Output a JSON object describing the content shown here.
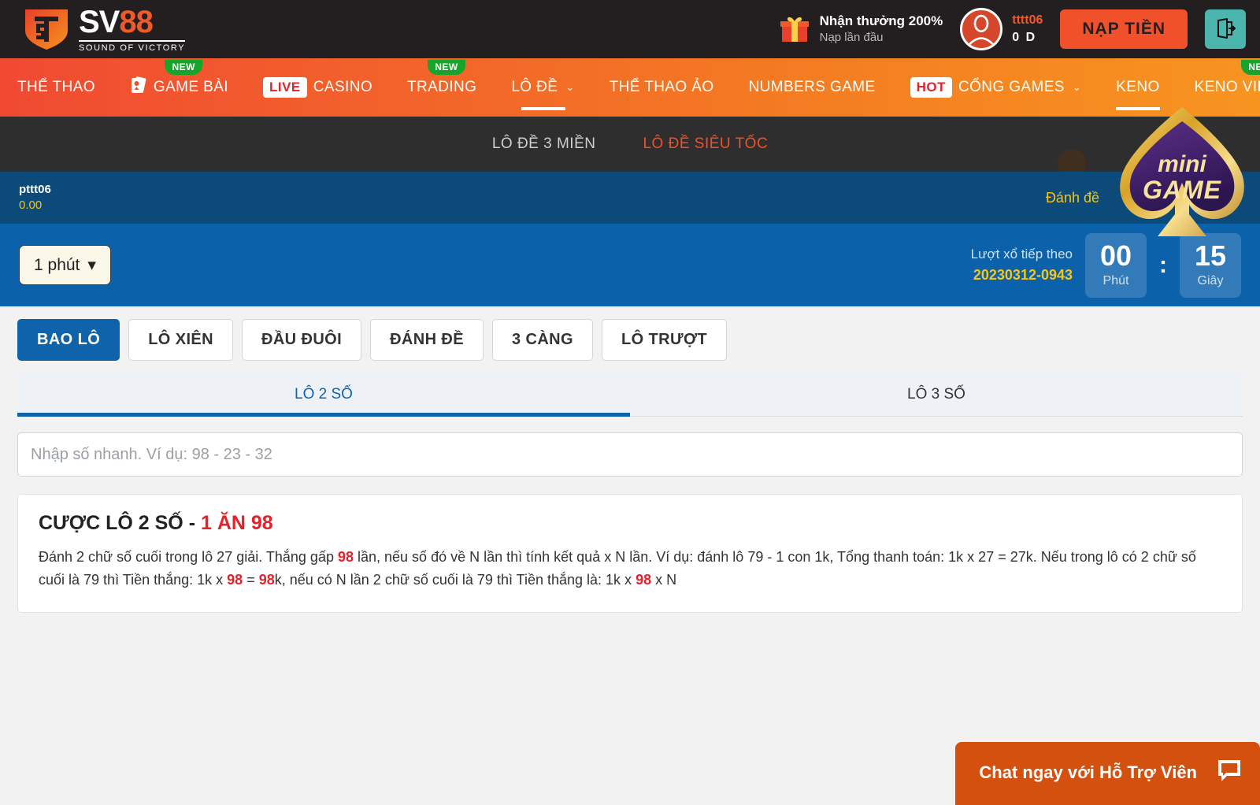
{
  "brand": {
    "name_main": "SV",
    "name_accent": "88",
    "tagline": "SOUND OF VICTORY",
    "logo_icon": "sv88-shield-logo",
    "accent_orange": "#f05a28",
    "dark": "#231f20"
  },
  "header": {
    "promo": {
      "icon": "gift-icon",
      "title": "Nhận thưởng 200%",
      "subtitle": "Nạp lần đầu"
    },
    "account": {
      "avatar_icon": "user-avatar-icon",
      "username": "tttt06",
      "balance": "0 D"
    },
    "deposit_label": "NẠP TIỀN",
    "logout_icon": "logout-icon"
  },
  "mainnav": {
    "items": [
      {
        "label": "THỂ THAO",
        "badge": "",
        "chip": "",
        "icon": "",
        "active": false,
        "caret": false
      },
      {
        "label": "GAME BÀI",
        "badge": "NEW",
        "chip": "",
        "icon": "cards-icon",
        "active": false,
        "caret": false
      },
      {
        "label": "CASINO",
        "badge": "",
        "chip": "LIVE",
        "icon": "",
        "active": false,
        "caret": false
      },
      {
        "label": "TRADING",
        "badge": "NEW",
        "chip": "",
        "icon": "",
        "active": false,
        "caret": false
      },
      {
        "label": "LÔ ĐỀ",
        "badge": "",
        "chip": "",
        "icon": "",
        "active": true,
        "caret": true
      },
      {
        "label": "THỂ THAO ẢO",
        "badge": "",
        "chip": "",
        "icon": "",
        "active": false,
        "caret": false
      },
      {
        "label": "NUMBERS GAME",
        "badge": "",
        "chip": "",
        "icon": "",
        "active": false,
        "caret": false
      },
      {
        "label": "CỔNG GAMES",
        "badge": "",
        "chip": "HOT",
        "icon": "",
        "active": false,
        "caret": true
      },
      {
        "label": "KENO",
        "badge": "",
        "chip": "",
        "icon": "",
        "active": true,
        "caret": false
      },
      {
        "label": "KENO VIETLOTT",
        "badge": "NEW",
        "chip": "",
        "icon": "",
        "active": false,
        "caret": false
      }
    ]
  },
  "subnav": {
    "items": [
      {
        "label": "LÔ ĐỀ 3 MIỀN",
        "active": false
      },
      {
        "label": "LÔ ĐỀ SIÊU TỐC",
        "active": true
      }
    ]
  },
  "userbar": {
    "username": "pttt06",
    "balance": "0.00",
    "right_label": "Đánh đề"
  },
  "timer": {
    "minute_select": "1 phút",
    "caret_icon": "caret-down-icon",
    "next_draw_label": "Lượt xổ tiếp theo",
    "draw_id": "20230312-0943",
    "minutes_value": "00",
    "minutes_label": "Phút",
    "separator": ":",
    "seconds_value": "15",
    "seconds_label": "Giây"
  },
  "bet_types": [
    {
      "label": "BAO LÔ",
      "active": true
    },
    {
      "label": "LÔ XIÊN",
      "active": false
    },
    {
      "label": "ĐẦU ĐUÔI",
      "active": false
    },
    {
      "label": "ĐÁNH ĐỀ",
      "active": false
    },
    {
      "label": "3 CÀNG",
      "active": false
    },
    {
      "label": "LÔ TRƯỢT",
      "active": false
    }
  ],
  "sub_tabs": [
    {
      "label": "LÔ 2 SỐ",
      "active": true
    },
    {
      "label": "LÔ 3 SỐ",
      "active": false
    }
  ],
  "quick_input": {
    "placeholder": "Nhập số nhanh. Ví dụ: 98 - 23 - 32",
    "value": ""
  },
  "info_card": {
    "title_prefix": "CƯỢC LÔ 2 SỐ - ",
    "title_rate": "1 ĂN 98",
    "body_parts": [
      {
        "t": "Đánh 2 chữ số cuối trong lô 27 giải. Thắng gấp ",
        "red": false
      },
      {
        "t": "98",
        "red": true
      },
      {
        "t": " lần, nếu số đó về N lần thì tính kết quả x N lần. Ví dụ: đánh lô 79 - 1 con 1k, Tổng thanh toán: 1k x 27 = 27k. Nếu trong lô có 2 chữ số cuối là 79 thì Tiền thắng: 1k x ",
        "red": false
      },
      {
        "t": "98",
        "red": true
      },
      {
        "t": " = ",
        "red": false
      },
      {
        "t": "98",
        "red": true
      },
      {
        "t": "k, nếu có N lần 2 chữ số cuối là 79 thì Tiền thắng là: 1k x ",
        "red": false
      },
      {
        "t": "98",
        "red": true
      },
      {
        "t": " x N",
        "red": false
      }
    ]
  },
  "minigame": {
    "line1": "mini",
    "line2": "GAME",
    "icon": "spade-minigame-badge"
  },
  "chat": {
    "label": "Chat ngay với Hỗ Trợ Viên",
    "icon": "chat-bubble-icon"
  }
}
